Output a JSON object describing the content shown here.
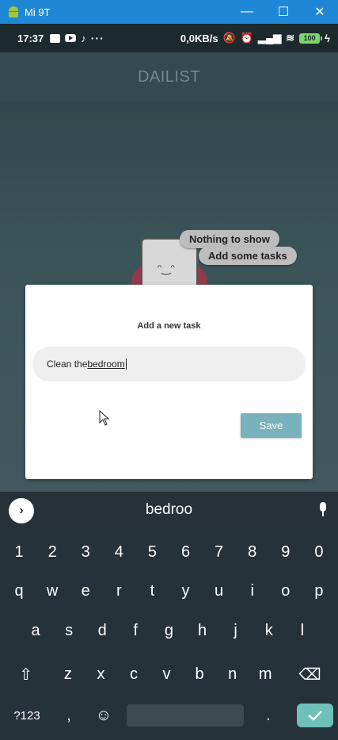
{
  "window": {
    "title": "Mi 9T",
    "minimize": "—",
    "maximize": "☐",
    "close": "✕"
  },
  "status_bar": {
    "time": "17:37",
    "more": "···",
    "net_speed": "0,0KB/s",
    "battery": "100"
  },
  "app": {
    "title": "DAILIST",
    "empty_state": {
      "line1": "Nothing to show",
      "line2": "Add some tasks"
    }
  },
  "dialog": {
    "title": "Add a new task",
    "input_prefix": "Clean the ",
    "input_word": "bedroom",
    "save_label": "Save"
  },
  "keyboard": {
    "suggestion": "bedroo",
    "numbers": [
      "1",
      "2",
      "3",
      "4",
      "5",
      "6",
      "7",
      "8",
      "9",
      "0"
    ],
    "row_q": [
      "q",
      "w",
      "e",
      "r",
      "t",
      "y",
      "u",
      "i",
      "o",
      "p"
    ],
    "row_a": [
      "a",
      "s",
      "d",
      "f",
      "g",
      "h",
      "j",
      "k",
      "l"
    ],
    "row_z": [
      "z",
      "x",
      "c",
      "v",
      "b",
      "n",
      "m"
    ],
    "sym_label": "?123",
    "comma": ",",
    "period": ".",
    "enter_color": "#6fc0b8"
  }
}
